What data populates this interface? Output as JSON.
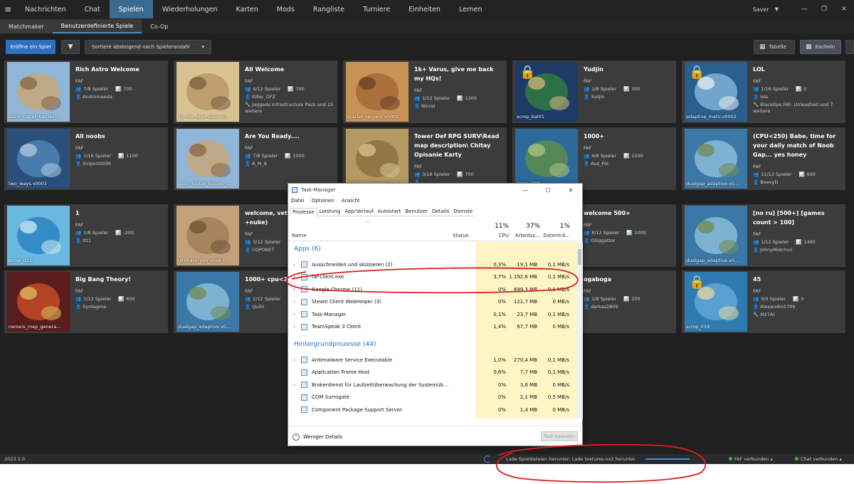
{
  "nav": {
    "menu_icon": "menu-icon",
    "tabs": [
      "Nachrichten",
      "Chat",
      "Spielen",
      "Wiederholungen",
      "Karten",
      "Mods",
      "Rangliste",
      "Turniere",
      "Einheiten",
      "Lernen"
    ],
    "active_tab": "Spielen",
    "user_name": "Saver"
  },
  "subnav": {
    "tabs": [
      "Matchmaker",
      "Benutzerdefinierte Spiele",
      "Co-Op"
    ],
    "active_tab": "Benutzerdefinierte Spiele"
  },
  "toolbar": {
    "create_label": "Eröffne ein Spiel",
    "sort_label": "Sortiere absteigend nach Spieleranzahl",
    "table_label": "Tabelle",
    "tiles_label": "Kacheln"
  },
  "games": [
    {
      "title": "Rich Astro Welcome",
      "feat": "FAF",
      "players": "7/8 Spieler",
      "rating": "700",
      "host": "Andromeeda",
      "map": "astro_crater_battles_..."
    },
    {
      "title": "All Welcome",
      "feat": "FAF",
      "players": "4/12 Spieler",
      "rating": "700",
      "host": "Killer_OFZ",
      "mods": "Jaggeds Infrastructure Pack und 15 weitere",
      "map": "12_the_epic_pass.v0..."
    },
    {
      "title": "1k+ Varus, give me back my HQs!",
      "feat": "FAF",
      "players": "1/12 Spieler",
      "rating": "1300",
      "host": "Ninrai",
      "map": "scarlet_serpent.v0002"
    },
    {
      "title": "Yudjin",
      "feat": "FAF",
      "players": "1/8 Spieler",
      "rating": "300",
      "host": "Yudjin",
      "map": "scmp_bal01",
      "locked": true
    },
    {
      "title": "LOL",
      "feat": "FAF",
      "players": "1/16 Spieler",
      "rating": "0",
      "host": "lols",
      "mods": "BlackOps FAF: Unleashed und 7 weitere",
      "map": "adaptive_metir.v0002",
      "locked": true
    },
    {
      "title": "All noobs",
      "feat": "FAF",
      "players": "1/16 Spieler",
      "rating": "1100",
      "host": "SniperD00M",
      "map": "two_ways.v0001"
    },
    {
      "title": "Are You Ready....",
      "feat": "FAF",
      "players": "7/8 Spieler",
      "rating": "1000",
      "host": "A_M_8",
      "map": "astro_crater_battles_..."
    },
    {
      "title": "Tower Def RPG SURV\\Read map description\\ Chitay Opisanie Karty",
      "feat": "FAF",
      "players": "3/16 Spieler",
      "rating": "700",
      "host": "",
      "map": "tower_defense_survi..."
    },
    {
      "title": "1000+",
      "feat": "FAF",
      "players": "4/8 Spieler",
      "rating": "1500",
      "host": "Aus_Pol",
      "map": "scmp_009"
    },
    {
      "title": "(CPU<250) Babe, time for your daily match of Noob Gap... yes honey",
      "feat": "FAF",
      "players": "11/12 Spieler",
      "rating": "600",
      "host": "BeevyD",
      "map": "dualgap_adaptive.v0..."
    },
    {
      "title": "1",
      "feat": "FAF",
      "players": "1/8 Spieler",
      "rating": "-200",
      "host": "ttt1",
      "map": "scmp_021"
    },
    {
      "title": "welcome, veteran (no eye, +nuke)",
      "feat": "FAF",
      "players": "3/12 Spieler",
      "rating": "",
      "host": "COPOKET",
      "map": "ultimate_you_shall_n..."
    },
    {
      "title": "",
      "feat": "",
      "players": "",
      "rating": "",
      "host": "",
      "map": ""
    },
    {
      "title": "welcome 500+",
      "feat": "FAF",
      "players": "8/12 Spieler",
      "rating": "1000",
      "host": "Oliiggattor",
      "map": ""
    },
    {
      "title": "[no ru] [500+] [games count > 100]",
      "feat": "FAF",
      "players": "1/12 Spieler",
      "rating": "1400",
      "host": "JohnyMolchun",
      "map": "dualgap_adaptive.v0..."
    },
    {
      "title": "Big Bang Theory!",
      "feat": "FAF",
      "players": "1/12 Spieler",
      "rating": "600",
      "host": "Syntagma",
      "map": "neroxis_map_genera..."
    },
    {
      "title": "1000+ cpu<220",
      "feat": "FAF",
      "players": "2/12 Spieler",
      "rating": "",
      "host": "Quitii",
      "map": "dualgap_adaptive.v0..."
    },
    {
      "title": "",
      "feat": "",
      "players": "",
      "rating": "",
      "host": "",
      "map": ""
    },
    {
      "title": "ogaboga",
      "feat": "FAF",
      "players": "1/8 Spieler",
      "rating": "200",
      "host": "darkas2809",
      "map": ""
    },
    {
      "title": "45",
      "feat": "FAF",
      "players": "0/4 Spieler",
      "rating": "0",
      "host": "Alexandro2709",
      "mods": "M27AI",
      "map": "scmp_039",
      "locked": true
    }
  ],
  "status": {
    "version": "2023.5.0",
    "download": "Lade Spieldateien herunter: Lade textures.nx2 herunter",
    "download_progress": 1.0,
    "faf": "FAF verbunden",
    "chat": "Chat verbunden",
    "ok_color": "#30c030"
  },
  "taskmanager": {
    "title": "Task-Manager",
    "menu": [
      "Datei",
      "Optionen",
      "Ansicht"
    ],
    "tabs": [
      "Prozesse",
      "Leistung",
      "App-Verlauf",
      "Autostart",
      "Benutzer",
      "Details",
      "Dienste"
    ],
    "active_tab": "Prozesse",
    "headers": {
      "name": "Name",
      "status": "Status",
      "cpu": "CPU",
      "mem": "Arbeitss...",
      "disk": "Datenträ..."
    },
    "totals": {
      "cpu": "11%",
      "mem": "37%",
      "disk": "1%"
    },
    "sections": [
      {
        "label": "Apps (6)",
        "rows": [
          {
            "name": "Ausschneiden und skizzieren (2)",
            "cpu": "0,3%",
            "mem": "19,1 MB",
            "disk": "0,1 MB/s",
            "expand": true
          },
          {
            "name": "faf-client.exe",
            "cpu": "3,7%",
            "mem": "1.192,6 MB",
            "disk": "0,1 MB/s",
            "expand": true
          },
          {
            "name": "Google Chrome (11)",
            "cpu": "0%",
            "mem": "699,3 MB",
            "disk": "0,1 MB/s",
            "expand": true
          },
          {
            "name": "Steam Client WebHelper (3)",
            "cpu": "0%",
            "mem": "121,7 MB",
            "disk": "0 MB/s",
            "expand": true
          },
          {
            "name": "Task-Manager",
            "cpu": "0,1%",
            "mem": "23,7 MB",
            "disk": "0,1 MB/s",
            "expand": true
          },
          {
            "name": "TeamSpeak 3 Client",
            "cpu": "1,4%",
            "mem": "67,7 MB",
            "disk": "0 MB/s",
            "expand": true
          }
        ]
      },
      {
        "label": "Hintergrundprozesse (44)",
        "rows": [
          {
            "name": "Antimalware Service Executable",
            "cpu": "1,0%",
            "mem": "270,4 MB",
            "disk": "0,1 MB/s",
            "expand": true
          },
          {
            "name": "Application Frame Host",
            "cpu": "0,6%",
            "mem": "7,7 MB",
            "disk": "0,1 MB/s",
            "expand": false
          },
          {
            "name": "Brokerdienst für Laufzeitüberwachung der Systemüberw...",
            "cpu": "0%",
            "mem": "3,6 MB",
            "disk": "0 MB/s",
            "expand": true
          },
          {
            "name": "COM Surrogate",
            "cpu": "0%",
            "mem": "2,1 MB",
            "disk": "0,5 MB/s",
            "expand": false
          },
          {
            "name": "Component Package Support Server",
            "cpu": "0%",
            "mem": "1,4 MB",
            "disk": "0 MB/s",
            "expand": false
          }
        ]
      }
    ],
    "less_details": "Weniger Details",
    "end_task": "Task beenden"
  }
}
